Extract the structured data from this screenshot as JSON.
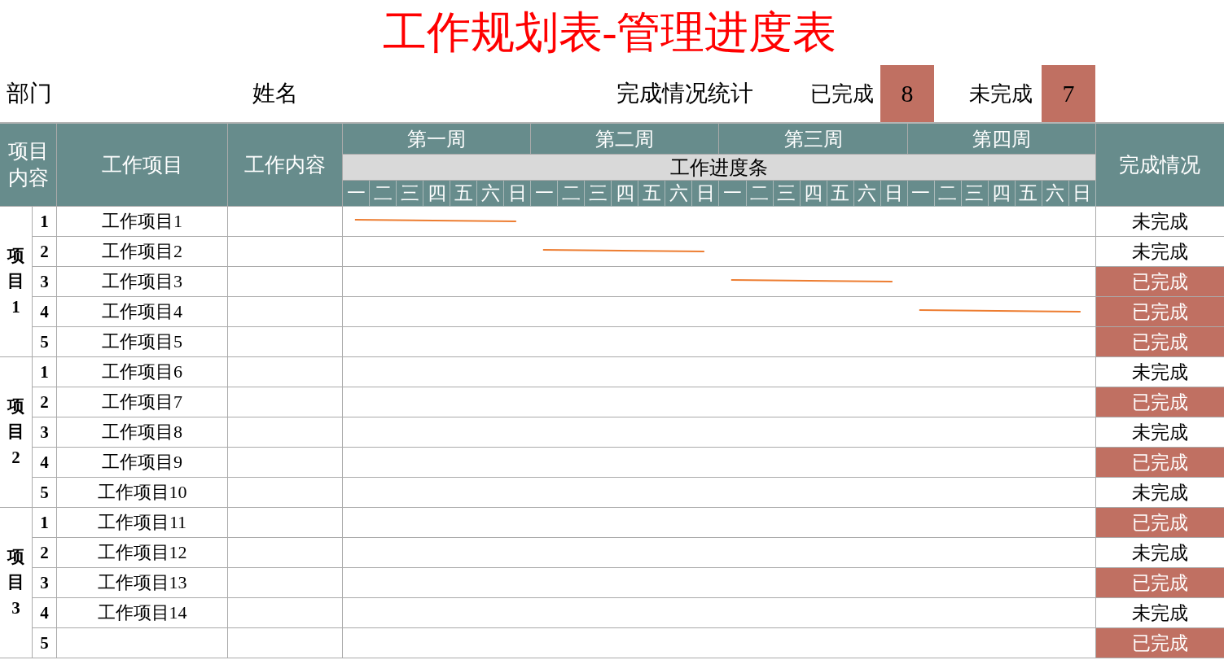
{
  "title": "工作规划表-管理进度表",
  "info": {
    "department_label": "部门",
    "name_label": "姓名",
    "stats_label": "完成情况统计",
    "done_label": "已完成",
    "done_count": "8",
    "todo_label": "未完成",
    "todo_count": "7"
  },
  "header": {
    "group": "项目内容",
    "item": "工作项目",
    "content": "工作内容",
    "progress_label": "工作进度条",
    "status": "完成情况",
    "weeks": [
      {
        "label": "第一周",
        "days": [
          "一",
          "二",
          "三",
          "四",
          "五",
          "六",
          "日"
        ]
      },
      {
        "label": "第二周",
        "days": [
          "一",
          "二",
          "三",
          "四",
          "五",
          "六",
          "日"
        ]
      },
      {
        "label": "第三周",
        "days": [
          "一",
          "二",
          "三",
          "四",
          "五",
          "六",
          "日"
        ]
      },
      {
        "label": "第四周",
        "days": [
          "一",
          "二",
          "三",
          "四",
          "五",
          "六",
          "日"
        ]
      }
    ]
  },
  "groups": [
    {
      "label": "项目1",
      "rows": [
        {
          "no": "1",
          "item": "工作项目1",
          "status": "未完成",
          "completed": false,
          "week_lines": [
            true,
            false,
            false,
            false
          ]
        },
        {
          "no": "2",
          "item": "工作项目2",
          "status": "未完成",
          "completed": false,
          "week_lines": [
            false,
            true,
            false,
            false
          ]
        },
        {
          "no": "3",
          "item": "工作项目3",
          "status": "已完成",
          "completed": true,
          "week_lines": [
            false,
            false,
            true,
            false
          ]
        },
        {
          "no": "4",
          "item": "工作项目4",
          "status": "已完成",
          "completed": true,
          "week_lines": [
            false,
            false,
            false,
            true
          ]
        },
        {
          "no": "5",
          "item": "工作项目5",
          "status": "已完成",
          "completed": true
        }
      ]
    },
    {
      "label": "项目2",
      "rows": [
        {
          "no": "1",
          "item": "工作项目6",
          "status": "未完成",
          "completed": false
        },
        {
          "no": "2",
          "item": "工作项目7",
          "status": "已完成",
          "completed": true
        },
        {
          "no": "3",
          "item": "工作项目8",
          "status": "未完成",
          "completed": false
        },
        {
          "no": "4",
          "item": "工作项目9",
          "status": "已完成",
          "completed": true
        },
        {
          "no": "5",
          "item": "工作项目10",
          "status": "未完成",
          "completed": false
        }
      ]
    },
    {
      "label": "项目3",
      "rows": [
        {
          "no": "1",
          "item": "工作项目11",
          "status": "已完成",
          "completed": true
        },
        {
          "no": "2",
          "item": "工作项目12",
          "status": "未完成",
          "completed": false
        },
        {
          "no": "3",
          "item": "工作项目13",
          "status": "已完成",
          "completed": true
        },
        {
          "no": "4",
          "item": "工作项目14",
          "status": "未完成",
          "completed": false
        },
        {
          "no": "5",
          "status": "已完成",
          "completed": true
        }
      ]
    }
  ]
}
